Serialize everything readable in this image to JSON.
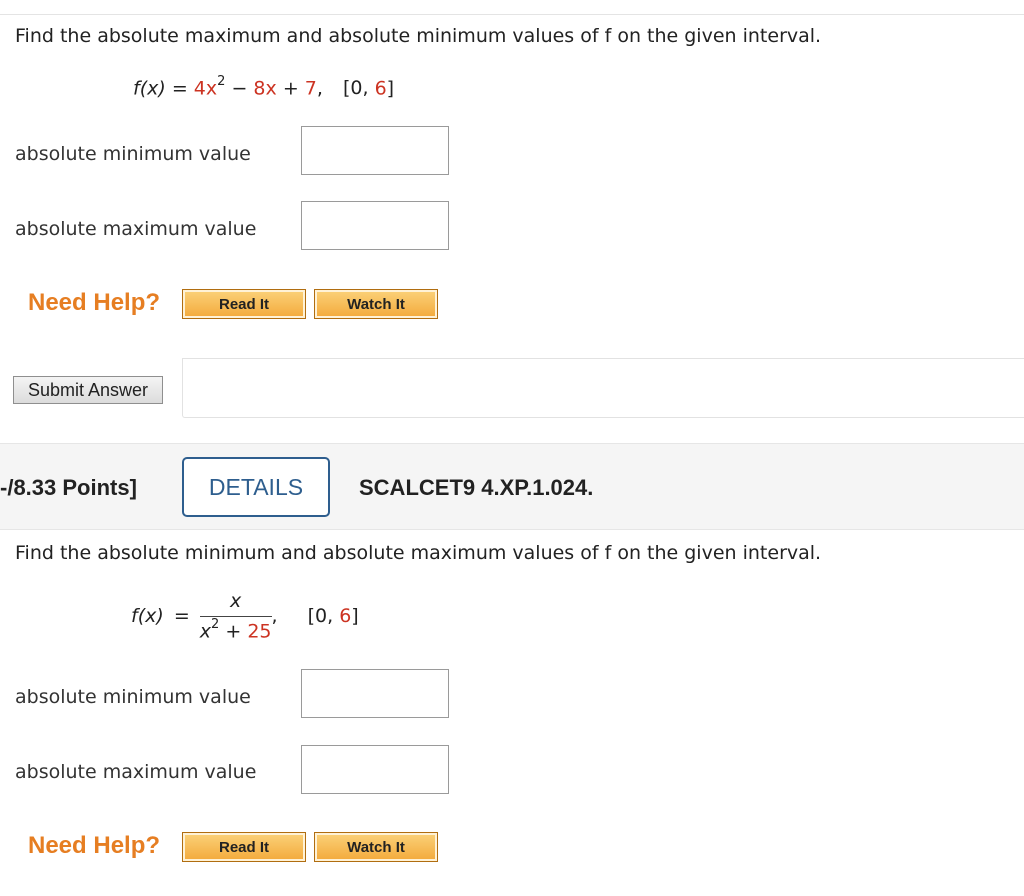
{
  "q1": {
    "prompt": "Find the absolute maximum and absolute minimum values of f on the given interval.",
    "function_lhs": "f(x)",
    "equals": "=",
    "term1": "4x",
    "exp": "2",
    "minus": "−",
    "term2": "8x",
    "plus": "+",
    "term3": "7",
    "comma": ",",
    "interval_open": "[0, ",
    "interval_end": "6",
    "interval_close": "]",
    "min_label": "absolute minimum value",
    "max_label": "absolute maximum value",
    "min_value": "",
    "max_value": "",
    "need_help": "Need Help?",
    "read_it": "Read It",
    "watch_it": "Watch It",
    "submit": "Submit Answer"
  },
  "q2_header": {
    "points": "-/8.33 Points]",
    "details": "DETAILS",
    "code": "SCALCET9 4.XP.1.024."
  },
  "q2": {
    "prompt": "Find the absolute minimum and absolute maximum values of f on the given interval.",
    "function_lhs": "f(x)",
    "equals": "=",
    "numerator": "x",
    "den_var": "x",
    "den_exp": "2",
    "den_plus": "+",
    "den_const": "25",
    "comma": ",",
    "interval_open": "[0, ",
    "interval_end": "6",
    "interval_close": "]",
    "min_label": "absolute minimum value",
    "max_label": "absolute maximum value",
    "min_value": "",
    "max_value": "",
    "need_help": "Need Help?",
    "read_it": "Read It",
    "watch_it": "Watch It"
  }
}
